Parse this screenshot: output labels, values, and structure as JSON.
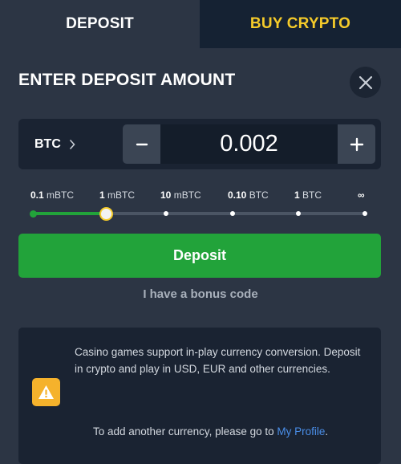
{
  "tabs": {
    "deposit": "DEPOSIT",
    "buy_crypto": "BUY CRYPTO"
  },
  "heading": "ENTER DEPOSIT AMOUNT",
  "amount": {
    "currency": "BTC",
    "value": "0.002"
  },
  "slider": {
    "labels": [
      {
        "num": "0.1",
        "unit": "mBTC"
      },
      {
        "num": "1",
        "unit": "mBTC"
      },
      {
        "num": "10",
        "unit": "mBTC"
      },
      {
        "num": "0.10",
        "unit": "BTC"
      },
      {
        "num": "1",
        "unit": "BTC"
      },
      {
        "num": "∞",
        "unit": ""
      }
    ],
    "selected_index": 1
  },
  "deposit_button": "Deposit",
  "bonus_link": "I have a bonus code",
  "info": {
    "text": "Casino games support in-play currency conversion. Deposit in crypto and play in USD, EUR and other currencies.",
    "profile_prefix": "To add another currency, please go to ",
    "profile_link": "My Profile",
    "profile_suffix": "."
  },
  "colors": {
    "accent_green": "#22a33a",
    "accent_yellow": "#f5cb2a",
    "link_blue": "#4a8ee8"
  }
}
